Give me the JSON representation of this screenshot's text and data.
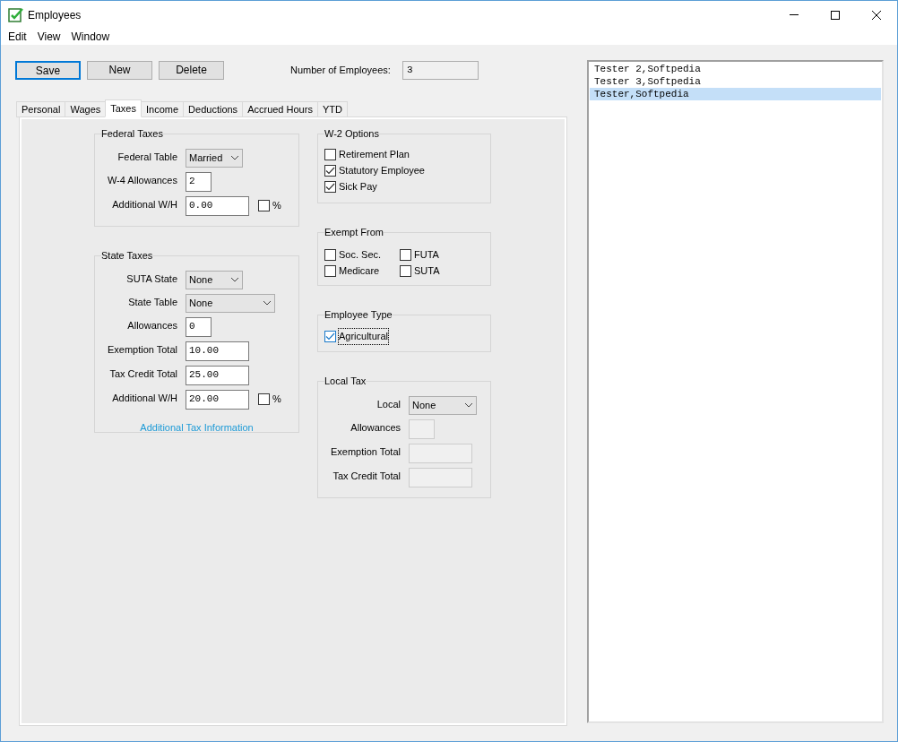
{
  "window": {
    "title": "Employees"
  },
  "menu": [
    "Edit",
    "View",
    "Window"
  ],
  "buttons": [
    {
      "label": "Save",
      "focused": true
    },
    {
      "label": "New",
      "focused": false
    },
    {
      "label": "Delete",
      "focused": false
    }
  ],
  "employee_count": {
    "label": "Number of Employees:",
    "value": "3"
  },
  "tabs": [
    {
      "label": "Personal",
      "selected": false
    },
    {
      "label": "Wages",
      "selected": false
    },
    {
      "label": "Taxes",
      "selected": true
    },
    {
      "label": "Income",
      "selected": false
    },
    {
      "label": "Deductions",
      "selected": false
    },
    {
      "label": "Accrued Hours",
      "selected": false
    },
    {
      "label": "YTD",
      "selected": false
    }
  ],
  "federal_taxes": {
    "title": "Federal Taxes",
    "rows": [
      {
        "label": "Federal Table",
        "kind": "select",
        "value": "Married"
      },
      {
        "label": "W-4 Allowances",
        "kind": "number",
        "value": "2"
      },
      {
        "label": "Additional W/H",
        "kind": "amount",
        "value": "0.00",
        "percent": {
          "label": "%",
          "checked": false
        }
      }
    ]
  },
  "state_taxes": {
    "title": "State Taxes",
    "rows": [
      {
        "label": "SUTA State",
        "kind": "select",
        "value": "None"
      },
      {
        "label": "State Table",
        "kind": "wideselect",
        "value": "None"
      },
      {
        "label": "Allowances",
        "kind": "number",
        "value": "0"
      },
      {
        "label": "Exemption Total",
        "kind": "amount",
        "value": "10.00"
      },
      {
        "label": "Tax Credit Total",
        "kind": "amount",
        "value": "25.00"
      },
      {
        "label": "Additional W/H",
        "kind": "amount",
        "value": "20.00",
        "percent": {
          "label": "%",
          "checked": false
        }
      }
    ],
    "link": "Additional Tax Information"
  },
  "w2_options": {
    "title": "W-2 Options",
    "items": [
      {
        "label": "Retirement Plan",
        "checked": false
      },
      {
        "label": "Statutory Employee",
        "checked": true
      },
      {
        "label": "Sick Pay",
        "checked": true
      }
    ]
  },
  "exempt_from": {
    "title": "Exempt From",
    "items": [
      {
        "label": "Soc. Sec.",
        "checked": false
      },
      {
        "label": "FUTA",
        "checked": false
      },
      {
        "label": "Medicare",
        "checked": false
      },
      {
        "label": "SUTA",
        "checked": false
      }
    ]
  },
  "employee_type": {
    "title": "Employee Type",
    "items": [
      {
        "label": "Agricultural",
        "checked": true,
        "focused": true
      }
    ]
  },
  "local_tax": {
    "title": "Local Tax",
    "rows": [
      {
        "label": "Local",
        "kind": "wideselect",
        "value": "None"
      },
      {
        "label": "Allowances",
        "kind": "number",
        "disabled": true
      },
      {
        "label": "Exemption Total",
        "kind": "amount",
        "disabled": true
      },
      {
        "label": "Tax Credit Total",
        "kind": "amount",
        "disabled": true
      }
    ]
  },
  "employees": [
    {
      "name": "Tester 2,Softpedia",
      "selected": false
    },
    {
      "name": "Tester 3,Softpedia",
      "selected": false
    },
    {
      "name": "Tester,Softpedia",
      "selected": true
    }
  ]
}
